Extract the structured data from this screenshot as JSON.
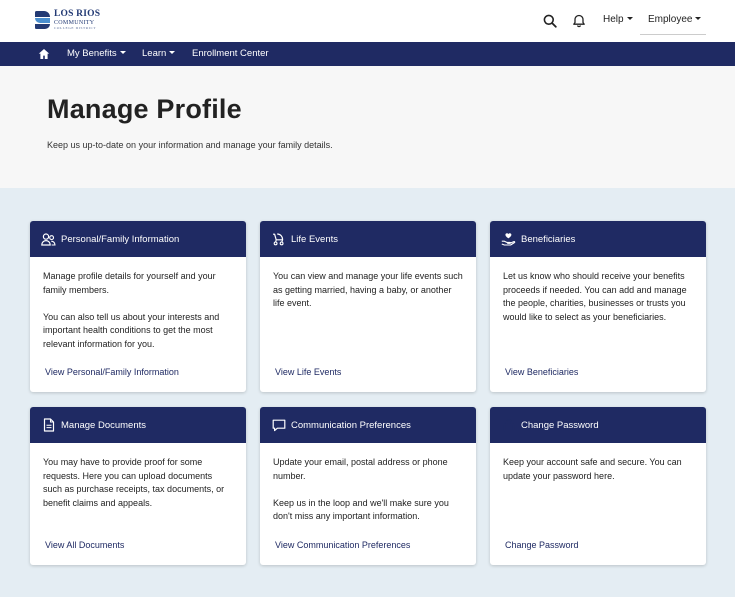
{
  "header": {
    "logo": {
      "line1": "LOS RIOS",
      "line2": "COMMUNITY",
      "line3": "COLLEGE DISTRICT"
    },
    "search_icon": "search-icon",
    "notifications_icon": "bell-icon",
    "help_label": "Help",
    "employee_label": "Employee"
  },
  "nav": {
    "home_icon": "home-icon",
    "items": [
      {
        "label": "My Benefits",
        "has_menu": true
      },
      {
        "label": "Learn",
        "has_menu": true
      },
      {
        "label": "Enrollment Center",
        "has_menu": false
      }
    ]
  },
  "hero": {
    "title": "Manage Profile",
    "subtitle": "Keep us up-to-date on your information and manage your family details."
  },
  "cards": [
    {
      "title": "Personal/Family Information",
      "icon": "people-icon",
      "paragraphs": [
        "Manage profile details for yourself and your family members.",
        "You can also tell us about your interests and important health conditions to get the most relevant information for you."
      ],
      "link": "View Personal/Family Information"
    },
    {
      "title": "Life Events",
      "icon": "stroller-icon",
      "paragraphs": [
        "You can view and manage your life events such as getting married, having a baby, or another life event."
      ],
      "link": "View Life Events"
    },
    {
      "title": "Beneficiaries",
      "icon": "hand-heart-icon",
      "paragraphs": [
        "Let us know who should receive your benefits proceeds if needed. You can add and manage the people, charities, businesses or trusts you would like to select as your beneficiaries."
      ],
      "link": "View Beneficiaries"
    },
    {
      "title": "Manage Documents",
      "icon": "document-icon",
      "paragraphs": [
        "You may have to provide proof for some requests. Here you can upload documents such as purchase receipts, tax documents, or benefit claims and appeals."
      ],
      "link": "View All Documents"
    },
    {
      "title": "Communication Preferences",
      "icon": "chat-icon",
      "paragraphs": [
        "Update your email, postal address or phone number.",
        "Keep us in the loop and we'll make sure you don't miss any important information."
      ],
      "link": "View Communication Preferences"
    },
    {
      "title": "Change Password",
      "icon": "lock-icon",
      "paragraphs": [
        "Keep your account safe and secure. You can update your password here."
      ],
      "link": "Change Password"
    }
  ],
  "colors": {
    "navy": "#1f2a63",
    "page_bg": "#e4edf3",
    "hero_bg": "#f7f7f7",
    "logo_blue": "#4a8fcf"
  }
}
